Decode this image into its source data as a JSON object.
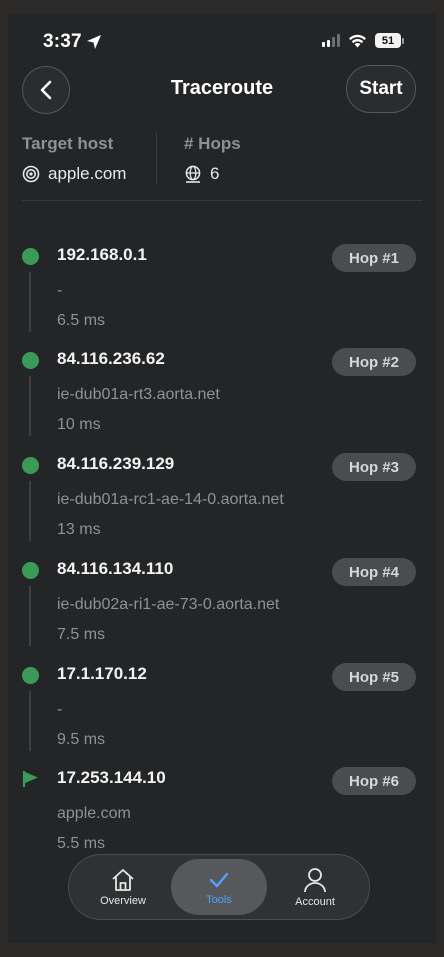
{
  "status_bar": {
    "time": "3:37",
    "battery": "51"
  },
  "header": {
    "title": "Traceroute",
    "start_label": "Start"
  },
  "info": {
    "target_label": "Target host",
    "target_value": "apple.com",
    "hops_label": "# Hops",
    "hops_value": "6"
  },
  "hops": [
    {
      "ip": "192.168.0.1",
      "host": "-",
      "latency": "6.5 ms",
      "badge": "Hop #1"
    },
    {
      "ip": "84.116.236.62",
      "host": "ie-dub01a-rt3.aorta.net",
      "latency": "10 ms",
      "badge": "Hop #2"
    },
    {
      "ip": "84.116.239.129",
      "host": "ie-dub01a-rc1-ae-14-0.aorta.net",
      "latency": "13 ms",
      "badge": "Hop #3"
    },
    {
      "ip": "84.116.134.110",
      "host": "ie-dub02a-ri1-ae-73-0.aorta.net",
      "latency": "7.5 ms",
      "badge": "Hop #4"
    },
    {
      "ip": "17.1.170.12",
      "host": "-",
      "latency": "9.5 ms",
      "badge": "Hop #5"
    },
    {
      "ip": "17.253.144.10",
      "host": "apple.com",
      "latency": "5.5 ms",
      "badge": "Hop #6"
    }
  ],
  "tabbar": {
    "overview": "Overview",
    "tools": "Tools",
    "account": "Account"
  },
  "colors": {
    "success": "#3b9a58",
    "accent": "#4ea3ff",
    "background": "#232527"
  },
  "icons": {
    "back": "chevron-left-icon",
    "target": "target-icon",
    "hops": "globe-icon",
    "destination": "flag-icon",
    "overview": "house-icon",
    "tools": "checkmark-icon",
    "account": "person-icon"
  }
}
